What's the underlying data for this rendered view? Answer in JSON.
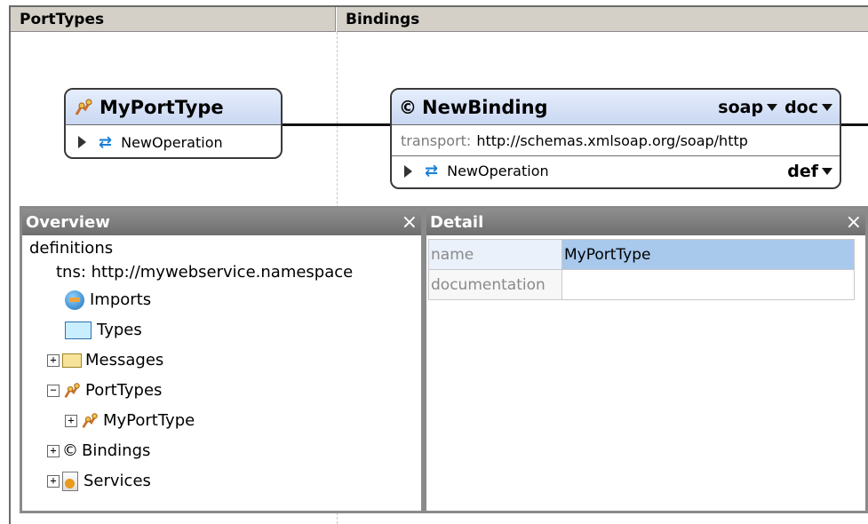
{
  "columns": {
    "porttypes_title": "PortTypes",
    "bindings_title": "Bindings"
  },
  "porttype_node": {
    "name": "MyPortType",
    "operation": "NewOperation"
  },
  "binding_node": {
    "name": "NewBinding",
    "protocol": "soap",
    "style": "doc",
    "transport_label": "transport:",
    "transport_value": "http://schemas.xmlsoap.org/soap/http",
    "operation": "NewOperation",
    "operation_style": "def"
  },
  "overview": {
    "title": "Overview",
    "close": "×",
    "items": {
      "definitions": "definitions",
      "tns": "tns:  http://mywebservice.namespace",
      "imports": "Imports",
      "types": "Types",
      "messages": "Messages",
      "porttypes": "PortTypes",
      "myporttype": "MyPortType",
      "bindings": "Bindings",
      "services": "Services"
    },
    "plus": "+",
    "minus": "−"
  },
  "detail": {
    "title": "Detail",
    "close": "×",
    "rows": [
      {
        "key": "name",
        "value": "MyPortType"
      },
      {
        "key": "documentation",
        "value": ""
      }
    ]
  }
}
